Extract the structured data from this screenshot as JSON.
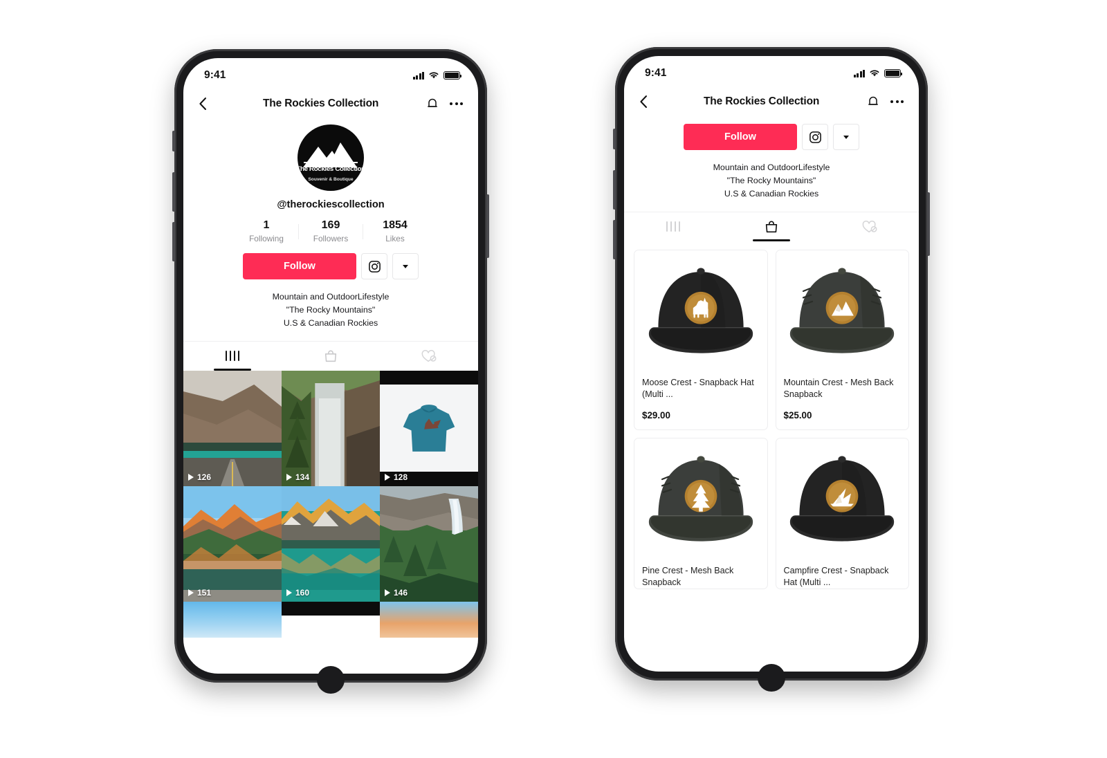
{
  "background": "#ffffff",
  "accent_color": "#fe2c55",
  "phones": {
    "left": {
      "status": {
        "time": "9:41"
      },
      "nav": {
        "title": "The Rockies Collection",
        "back_icon": "chevron-left-icon",
        "bell_icon": "bell-icon",
        "more_icon": "more-dots-icon"
      },
      "profile": {
        "avatar_logo_title": "The Rockies Collection",
        "avatar_logo_subtitle": "Souvenir & Boutique",
        "handle": "@therockiescollection",
        "stats": [
          {
            "num": "1",
            "label": "Following"
          },
          {
            "num": "169",
            "label": "Followers"
          },
          {
            "num": "1854",
            "label": "Likes"
          }
        ],
        "follow_label": "Follow",
        "instagram_icon": "instagram-icon",
        "dropdown_icon": "caret-down-icon",
        "bio_lines": [
          "Mountain and OutdoorLifestyle",
          "\"The Rocky Mountains\"",
          "U.S & Canadian Rockies"
        ]
      },
      "tabs": [
        {
          "name": "videos",
          "icon": "grid-icon",
          "active": true
        },
        {
          "name": "shop",
          "icon": "shopping-bag-icon",
          "active": false
        },
        {
          "name": "liked",
          "icon": "heart-private-icon",
          "active": false
        }
      ],
      "video_grid": [
        {
          "views": "126",
          "scene": "mountain road with turquoise lake"
        },
        {
          "views": "134",
          "scene": "waterfall through evergreen forest"
        },
        {
          "views": "128",
          "scene": "teal hoodie product"
        },
        {
          "views": "151",
          "scene": "maroon bells alpenglow reflection"
        },
        {
          "views": "160",
          "scene": "moraine lake sunrise reflection"
        },
        {
          "views": "146",
          "scene": "takakkaw falls and pines"
        }
      ]
    },
    "right": {
      "status": {
        "time": "9:41"
      },
      "nav": {
        "title": "The Rockies Collection",
        "back_icon": "chevron-left-icon",
        "bell_icon": "bell-icon",
        "more_icon": "more-dots-icon"
      },
      "profile": {
        "follow_label": "Follow",
        "instagram_icon": "instagram-icon",
        "dropdown_icon": "caret-down-icon",
        "bio_lines": [
          "Mountain and OutdoorLifestyle",
          "\"The Rocky Mountains\"",
          "U.S & Canadian Rockies"
        ]
      },
      "tabs": [
        {
          "name": "videos",
          "icon": "grid-icon",
          "active": false
        },
        {
          "name": "shop",
          "icon": "shopping-bag-icon",
          "active": true
        },
        {
          "name": "liked",
          "icon": "heart-private-icon",
          "active": false
        }
      ],
      "products": [
        {
          "title": "Moose Crest - Snapback Hat (Multi ...",
          "price": "$29.00",
          "crest": "moose-crest-icon",
          "hat_color": "#232323"
        },
        {
          "title": "Mountain Crest - Mesh Back Snapback",
          "price": "$25.00",
          "crest": "mountain-crest-icon",
          "hat_color": "#3b3e3b"
        },
        {
          "title": "Pine Crest - Mesh Back Snapback",
          "price": "",
          "crest": "pine-crest-icon",
          "hat_color": "#3b3e3b"
        },
        {
          "title": "Campfire Crest - Snapback Hat (Multi ...",
          "price": "",
          "crest": "campfire-crest-icon",
          "hat_color": "#232323"
        }
      ],
      "crest_badge_color": "#b5812f"
    }
  }
}
